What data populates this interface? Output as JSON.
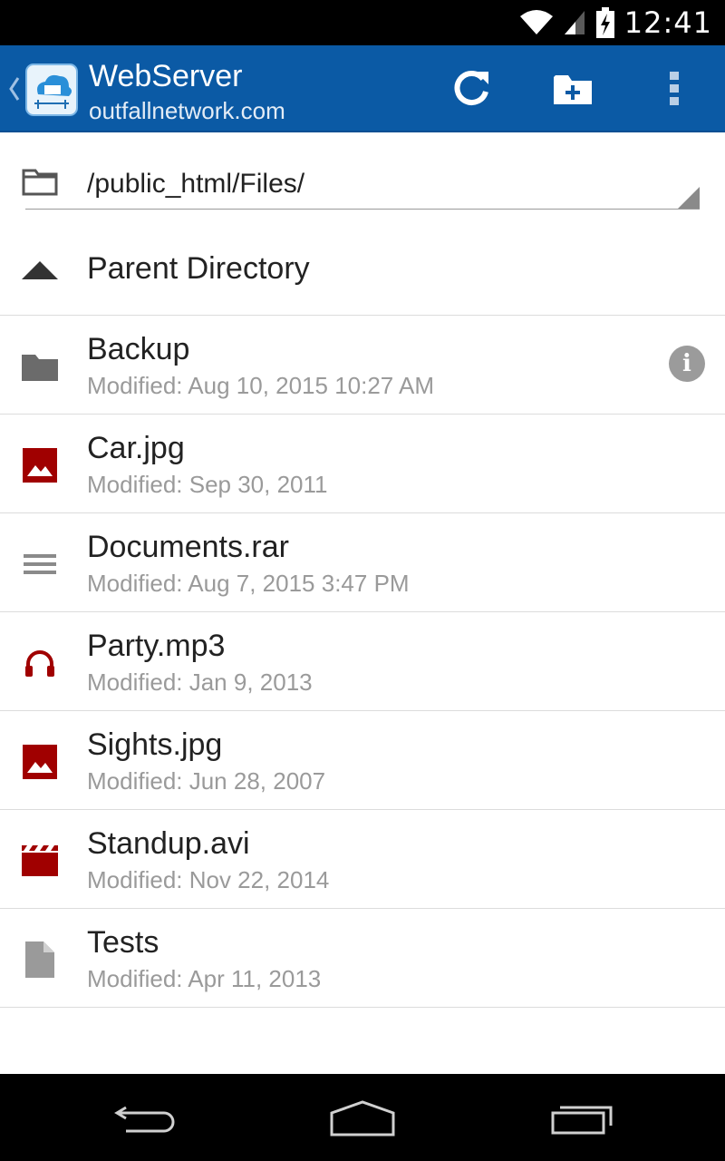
{
  "status_bar": {
    "time": "12:41"
  },
  "action_bar": {
    "title": "WebServer",
    "subtitle": "outfallnetwork.com",
    "accent": "#0b5aa5"
  },
  "path": {
    "current": "/public_html/Files/"
  },
  "parent": {
    "label": "Parent Directory"
  },
  "files": [
    {
      "name": "Backup",
      "modified": "Modified: Aug 10, 2015 10:27 AM",
      "icon": "folder-icon",
      "has_info": true
    },
    {
      "name": "Car.jpg",
      "modified": "Modified: Sep 30, 2011",
      "icon": "image-icon"
    },
    {
      "name": "Documents.rar",
      "modified": "Modified: Aug 7, 2015 3:47 PM",
      "icon": "archive-icon"
    },
    {
      "name": "Party.mp3",
      "modified": "Modified: Jan 9, 2013",
      "icon": "headphones-icon"
    },
    {
      "name": "Sights.jpg",
      "modified": "Modified: Jun 28, 2007",
      "icon": "image-icon"
    },
    {
      "name": "Standup.avi",
      "modified": "Modified: Nov 22, 2014",
      "icon": "video-icon"
    },
    {
      "name": "Tests",
      "modified": "Modified: Apr 11, 2013",
      "icon": "document-icon"
    }
  ],
  "colors": {
    "media_red": "#a00000",
    "gray_icon": "#6b6b6b"
  }
}
